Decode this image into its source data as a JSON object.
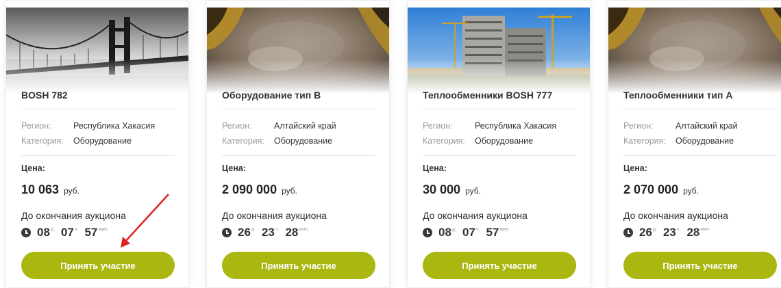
{
  "colors": {
    "accent": "#aab710",
    "arrow": "#e02020",
    "label_gray": "#9a9a9a",
    "text_dark": "#333333"
  },
  "cards": [
    {
      "image": "bridge-photo",
      "title": "BOSH 782",
      "region_label": "Регион:",
      "region_value": "Республика Хакасия",
      "category_label": "Категория:",
      "category_value": "Оборудование",
      "price_label": "Цена:",
      "price": "10 063",
      "currency": "руб.",
      "auction_label": "До окончания аукциона",
      "timer": {
        "days": "08",
        "days_unit": "д.",
        "hours": "07",
        "hours_unit": "ч.",
        "minutes": "57",
        "minutes_unit": "мин."
      },
      "button": "Принять участие"
    },
    {
      "image": "machinery-photo",
      "title": "Оборудование тип B",
      "region_label": "Регион:",
      "region_value": "Алтайский край",
      "category_label": "Категория:",
      "category_value": "Оборудование",
      "price_label": "Цена:",
      "price": "2 090 000",
      "currency": "руб.",
      "auction_label": "До окончания аукциона",
      "timer": {
        "days": "26",
        "days_unit": "д.",
        "hours": "23",
        "hours_unit": "ч.",
        "minutes": "28",
        "minutes_unit": "мин."
      },
      "button": "Принять участие"
    },
    {
      "image": "construction-photo",
      "title": "Теплообменники BOSH 777",
      "region_label": "Регион:",
      "region_value": "Республика Хакасия",
      "category_label": "Категория:",
      "category_value": "Оборудование",
      "price_label": "Цена:",
      "price": "30 000",
      "currency": "руб.",
      "auction_label": "До окончания аукциона",
      "timer": {
        "days": "08",
        "days_unit": "д.",
        "hours": "07",
        "hours_unit": "ч.",
        "minutes": "57",
        "minutes_unit": "мин."
      },
      "button": "Принять участие"
    },
    {
      "image": "machinery-photo",
      "title": "Теплообменники тип А",
      "region_label": "Регион:",
      "region_value": "Алтайский край",
      "category_label": "Категория:",
      "category_value": "Оборудование",
      "price_label": "Цена:",
      "price": "2 070 000",
      "currency": "руб.",
      "auction_label": "До окончания аукциона",
      "timer": {
        "days": "26",
        "days_unit": "д.",
        "hours": "23",
        "hours_unit": "ч.",
        "minutes": "28",
        "minutes_unit": "мин."
      },
      "button": "Принять участие"
    }
  ]
}
